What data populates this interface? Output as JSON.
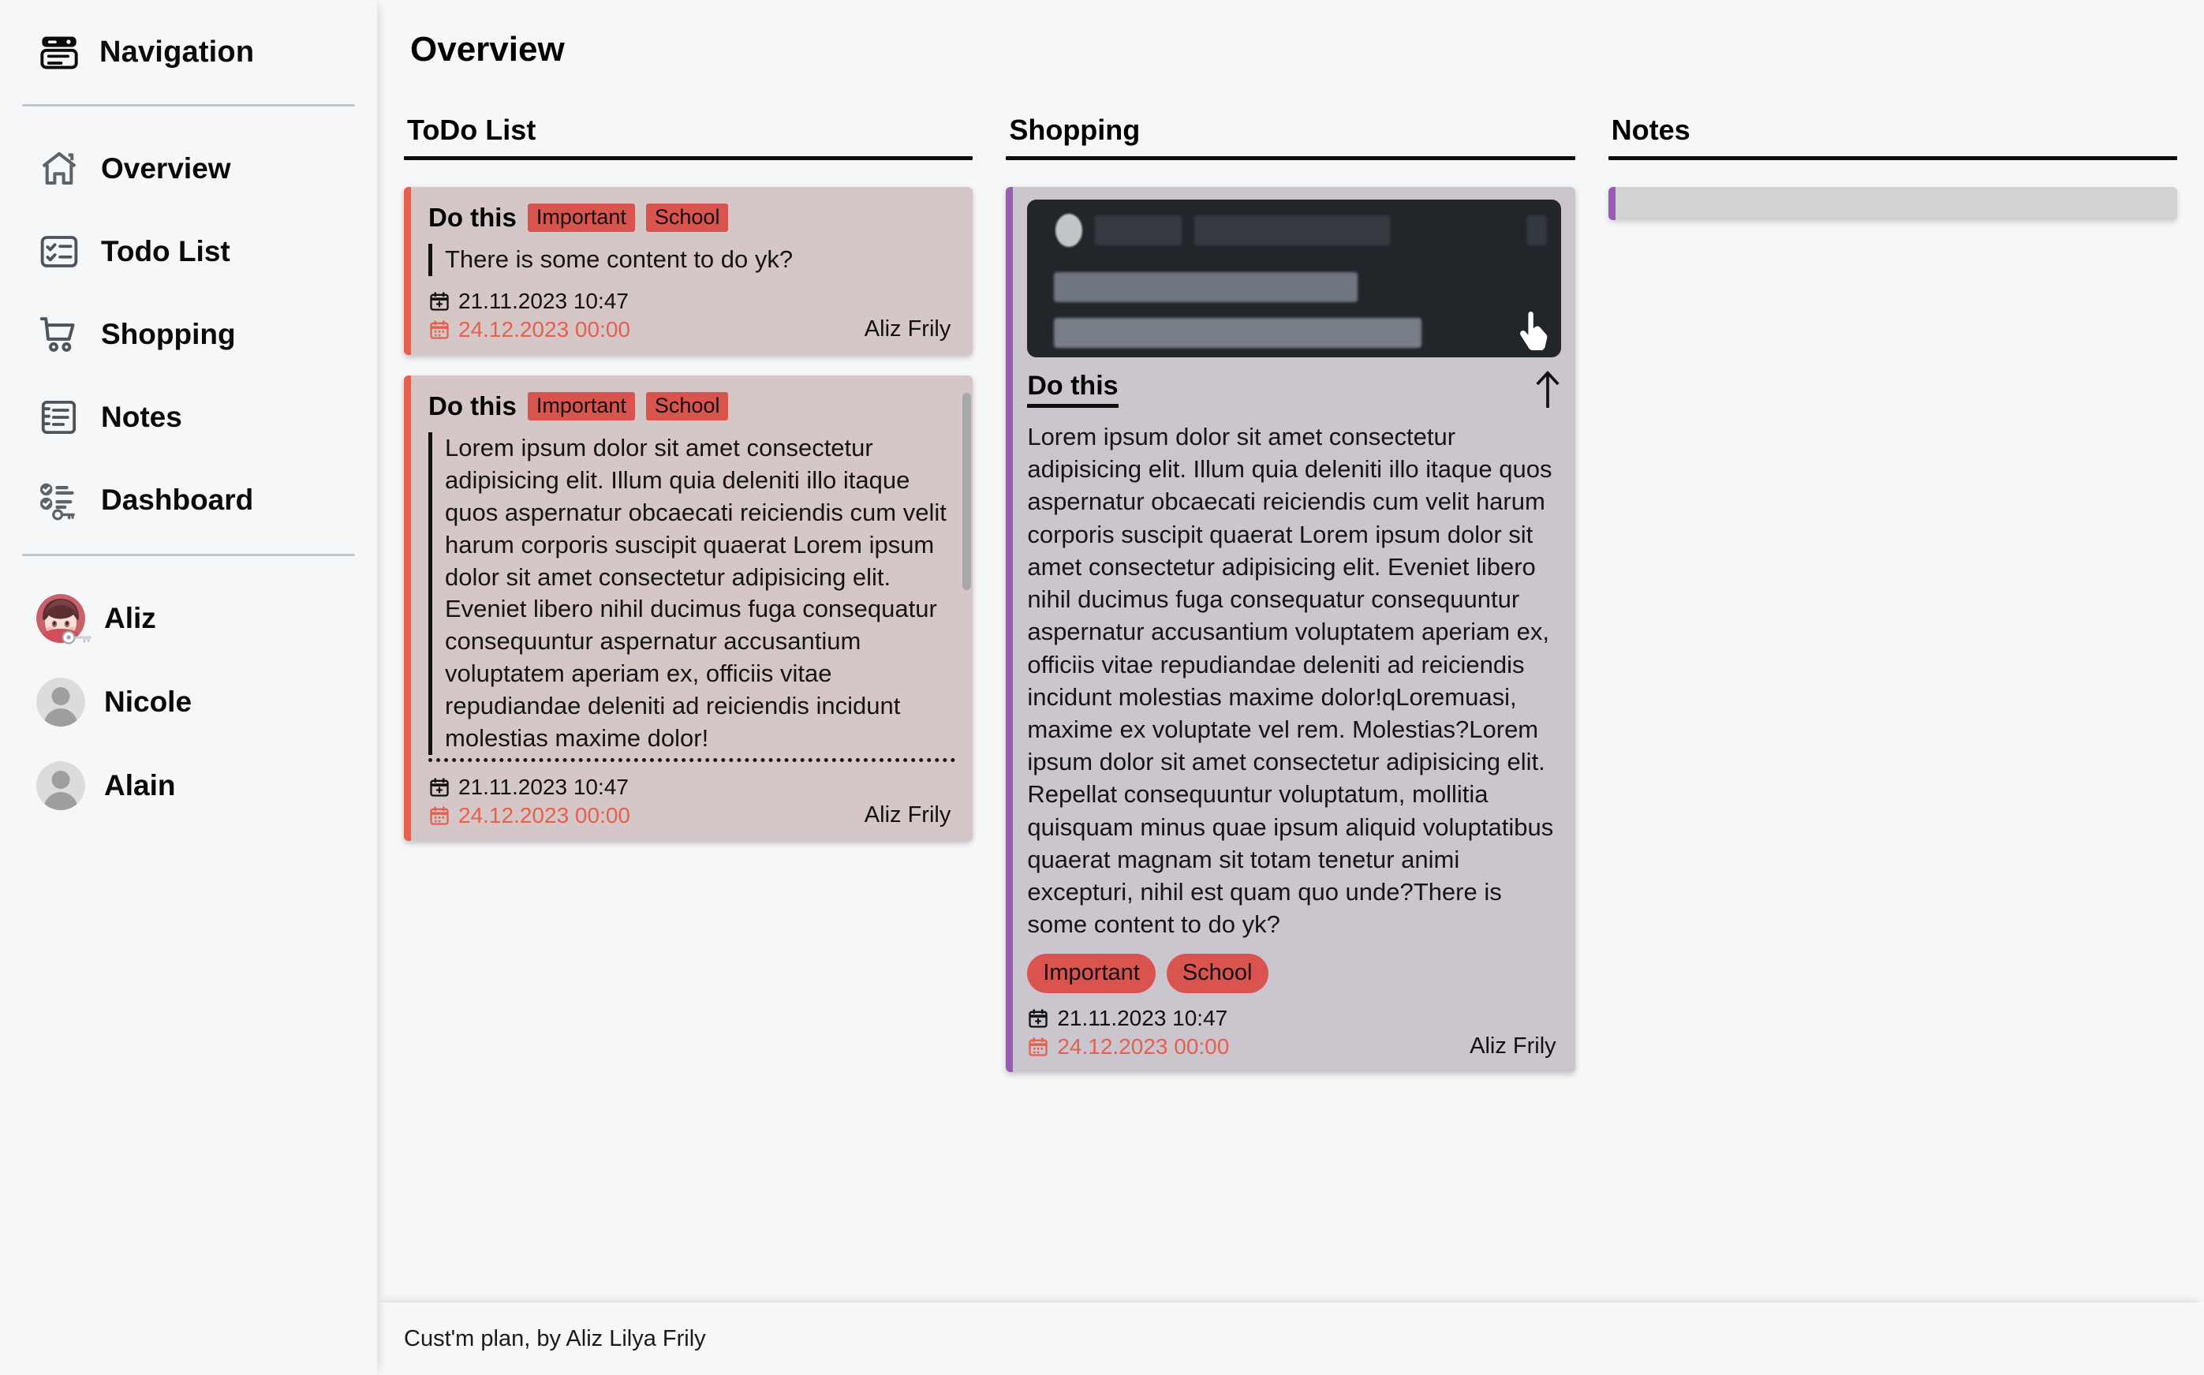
{
  "sidebar": {
    "brand": {
      "label": "Navigation",
      "icon": "navigation-panel-icon"
    },
    "items": [
      {
        "label": "Overview",
        "icon": "home-icon"
      },
      {
        "label": "Todo List",
        "icon": "checklist-icon"
      },
      {
        "label": "Shopping",
        "icon": "shopping-cart-icon"
      },
      {
        "label": "Notes",
        "icon": "notes-icon"
      },
      {
        "label": "Dashboard",
        "icon": "dashboard-key-icon"
      }
    ],
    "people": [
      {
        "name": "Aliz",
        "avatar": "anime-portrait-avatar",
        "has_key": true
      },
      {
        "name": "Nicole",
        "avatar": "placeholder-person-avatar",
        "has_key": false
      },
      {
        "name": "Alain",
        "avatar": "placeholder-person-avatar",
        "has_key": false
      }
    ]
  },
  "main": {
    "page_title": "Overview",
    "columns": {
      "todo": {
        "heading": "ToDo List",
        "cards": [
          {
            "title": "Do this",
            "tags": [
              "Important",
              "School"
            ],
            "content": "There is some content to do yk?",
            "created": "21.11.2023 10:47",
            "due": "24.12.2023 00:00",
            "author": "Aliz Frily",
            "truncated": false
          },
          {
            "title": "Do this",
            "tags": [
              "Important",
              "School"
            ],
            "content": "Lorem ipsum dolor sit amet consectetur adipisicing elit. Illum quia deleniti illo itaque quos aspernatur obcaecati reiciendis cum velit harum corporis suscipit quaerat Lorem ipsum dolor sit amet consectetur adipisicing elit. Eveniet libero nihil ducimus fuga consequatur consequuntur aspernatur accusantium voluptatem aperiam ex, officiis vitae repudiandae deleniti ad reiciendis incidunt molestias maxime dolor!",
            "created": "21.11.2023 10:47",
            "due": "24.12.2023 00:00",
            "author": "Aliz Frily",
            "truncated": true
          }
        ]
      },
      "shopping": {
        "heading": "Shopping",
        "card": {
          "preview_icon": "dark-skeleton-preview",
          "cursor_icon": "pointer-hand-icon",
          "collapse_icon": "arrow-up-icon",
          "title": "Do this",
          "content": "Lorem ipsum dolor sit amet consectetur adipisicing elit. Illum quia deleniti illo itaque quos aspernatur obcaecati reiciendis cum velit harum corporis suscipit quaerat Lorem ipsum dolor sit amet consectetur adipisicing elit. Eveniet libero nihil ducimus fuga consequatur consequuntur aspernatur accusantium voluptatem aperiam ex, officiis vitae repudiandae deleniti ad reiciendis incidunt molestias maxime dolor!qLoremuasi, maxime ex voluptate vel rem. Molestias?Lorem ipsum dolor sit amet consectetur adipisicing elit. Repellat consequuntur voluptatum, mollitia quisquam minus quae ipsum aliquid voluptatibus quaerat magnam sit totam tenetur animi excepturi, nihil est quam quo unde?There is some content to do yk?",
          "tags": [
            "Important",
            "School"
          ],
          "created": "21.11.2023 10:47",
          "due": "24.12.2023 00:00",
          "author": "Aliz Frily"
        }
      },
      "notes": {
        "heading": "Notes",
        "empty_card": ""
      }
    }
  },
  "footer": {
    "text": "Cust'm plan, by Aliz Lilya Frily"
  },
  "colors": {
    "accent_red": "#d9534f",
    "card_red_border": "#e4604f",
    "accent_purple": "#9b59b6",
    "todo_card_bg": "#d5c7c7",
    "shop_card_bg": "#cbc5cd",
    "note_card_bg": "#d2d2d2",
    "page_bg": "#f6f7f9"
  }
}
